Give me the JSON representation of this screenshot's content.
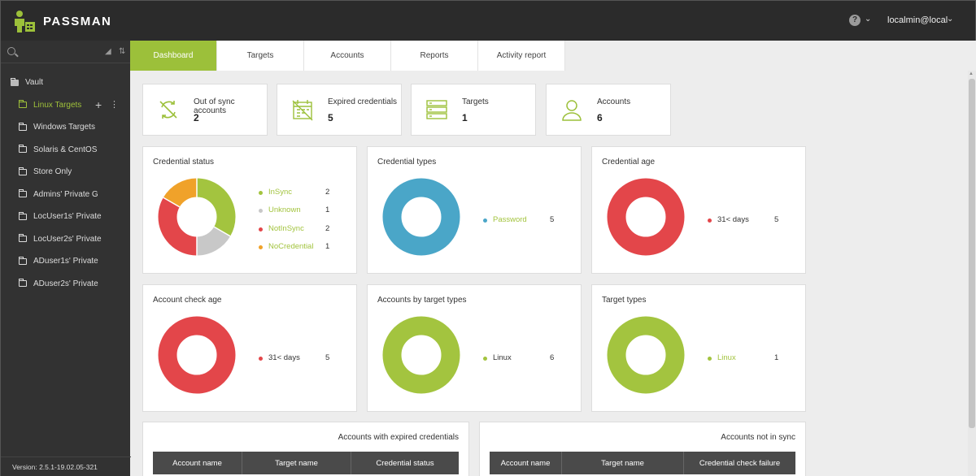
{
  "app": {
    "name": "PASSMAN"
  },
  "header": {
    "help_label": "?",
    "user": "localmin@local"
  },
  "sidebar": {
    "root": "Vault",
    "items": [
      {
        "label": "Linux Targets",
        "active": true
      },
      {
        "label": "Windows Targets"
      },
      {
        "label": "Solaris & CentOS"
      },
      {
        "label": "Store Only"
      },
      {
        "label": "Admins' Private G"
      },
      {
        "label": "LocUser1s' Private"
      },
      {
        "label": "LocUser2s' Private"
      },
      {
        "label": "ADuser1s' Private"
      },
      {
        "label": "ADuser2s' Private"
      }
    ],
    "version": "Version: 2.5.1-19.02.05-321"
  },
  "tabs": [
    "Dashboard",
    "Targets",
    "Accounts",
    "Reports",
    "Activity report"
  ],
  "stats": [
    {
      "label": "Out of sync accounts",
      "value": "2",
      "icon": "sync-off-icon"
    },
    {
      "label": "Expired credentials",
      "value": "5",
      "icon": "calendar-expired-icon"
    },
    {
      "label": "Targets",
      "value": "1",
      "icon": "server-icon"
    },
    {
      "label": "Accounts",
      "value": "6",
      "icon": "user-icon"
    }
  ],
  "colors": {
    "accent": "#9cc03a",
    "green": "#a3c43f",
    "red": "#e3464a",
    "blue": "#4aa6c8",
    "orange": "#f0a22a",
    "gray": "#c8c8c8"
  },
  "charts": [
    {
      "title": "Credential status",
      "slices": [
        {
          "name": "InSync",
          "value": 2,
          "color": "#a3c43f"
        },
        {
          "name": "Unknown",
          "value": 1,
          "color": "#c8c8c8"
        },
        {
          "name": "NotInSync",
          "value": 2,
          "color": "#e3464a"
        },
        {
          "name": "NoCredential",
          "value": 1,
          "color": "#f0a22a"
        }
      ]
    },
    {
      "title": "Credential types",
      "slices": [
        {
          "name": "Password",
          "value": 5,
          "color": "#4aa6c8"
        }
      ]
    },
    {
      "title": "Credential age",
      "slices": [
        {
          "name": "31< days",
          "value": 5,
          "color": "#e3464a"
        }
      ]
    },
    {
      "title": "Account check age",
      "slices": [
        {
          "name": "31< days",
          "value": 5,
          "color": "#e3464a"
        }
      ]
    },
    {
      "title": "Accounts by target types",
      "slices": [
        {
          "name": "Linux",
          "value": 6,
          "color": "#a3c43f"
        }
      ]
    },
    {
      "title": "Target types",
      "slices": [
        {
          "name": "Linux",
          "value": 1,
          "color": "#a3c43f"
        }
      ]
    }
  ],
  "tables": [
    {
      "title": "Accounts with expired credentials",
      "columns": [
        "Account name",
        "Target name",
        "Credential status"
      ]
    },
    {
      "title": "Accounts not in sync",
      "columns": [
        "Account name",
        "Target name",
        "Credential check failure"
      ]
    }
  ]
}
